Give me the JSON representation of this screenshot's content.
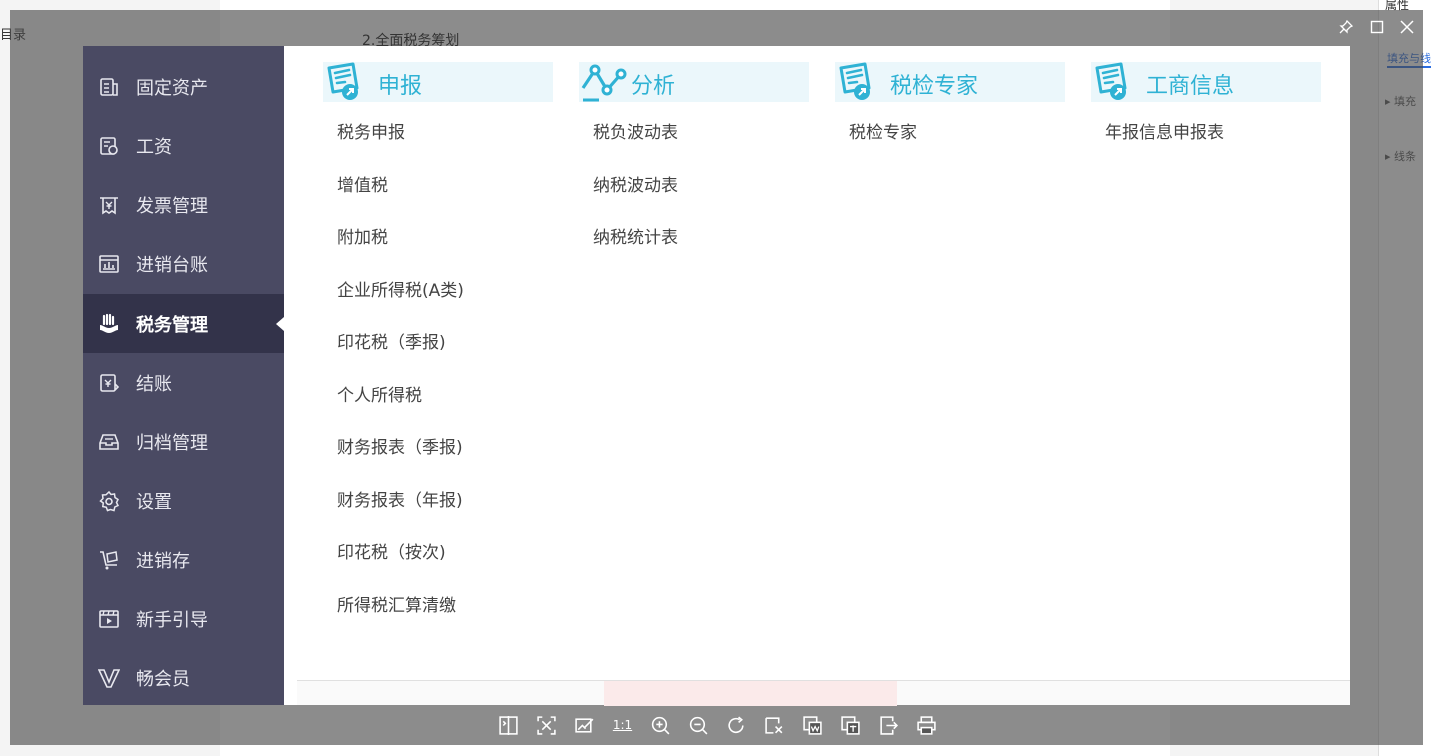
{
  "background": {
    "left_label": "目录",
    "doc_heading": "2.全面税务筹划",
    "right_panel": {
      "title": "属性",
      "tab": "填充与线",
      "items": [
        "填充",
        "线条"
      ]
    }
  },
  "viewer": {
    "controls": [
      "pin-icon",
      "maximize-icon",
      "close-icon"
    ],
    "toolbar": [
      {
        "name": "split-view-icon"
      },
      {
        "name": "fit-screen-icon"
      },
      {
        "name": "edit-image-icon"
      },
      {
        "name": "actual-size-button",
        "label": "1:1"
      },
      {
        "name": "zoom-in-icon"
      },
      {
        "name": "zoom-out-icon"
      },
      {
        "name": "rotate-icon"
      },
      {
        "name": "crop-icon"
      },
      {
        "name": "image-to-text-icon"
      },
      {
        "name": "image-translate-icon"
      },
      {
        "name": "export-icon"
      },
      {
        "name": "print-icon"
      }
    ]
  },
  "sidebar": {
    "items": [
      {
        "label": "固定资产",
        "icon": "fixed-assets-icon"
      },
      {
        "label": "工资",
        "icon": "salary-icon"
      },
      {
        "label": "发票管理",
        "icon": "invoice-icon"
      },
      {
        "label": "进销台账",
        "icon": "ledger-icon"
      },
      {
        "label": "税务管理",
        "icon": "tax-icon",
        "active": true
      },
      {
        "label": "结账",
        "icon": "checkout-icon"
      },
      {
        "label": "归档管理",
        "icon": "archive-icon"
      },
      {
        "label": "设置",
        "icon": "gear-icon"
      },
      {
        "label": "进销存",
        "icon": "inventory-icon"
      },
      {
        "label": "新手引导",
        "icon": "guide-video-icon"
      },
      {
        "label": "畅会员",
        "icon": "vip-icon"
      }
    ]
  },
  "columns": [
    {
      "title": "申报",
      "icon": "declare-doc-icon",
      "items": [
        "税务申报",
        "增值税",
        "附加税",
        "企业所得税(A类)",
        "印花税（季报)",
        "个人所得税",
        "财务报表（季报)",
        "财务报表（年报)",
        "印花税（按次)",
        "所得税汇算清缴"
      ]
    },
    {
      "title": "分析",
      "icon": "analysis-chart-icon",
      "items": [
        "税负波动表",
        "纳税波动表",
        "纳税统计表"
      ]
    },
    {
      "title": "税检专家",
      "icon": "tax-check-doc-icon",
      "items": [
        "税检专家"
      ]
    },
    {
      "title": "工商信息",
      "icon": "business-info-doc-icon",
      "items": [
        "年报信息申报表"
      ]
    }
  ],
  "colors": {
    "sidebar_bg": "#4a4a63",
    "sidebar_active": "#33334a",
    "accent": "#2fb2d4",
    "header_bg": "#ebf7fb"
  }
}
